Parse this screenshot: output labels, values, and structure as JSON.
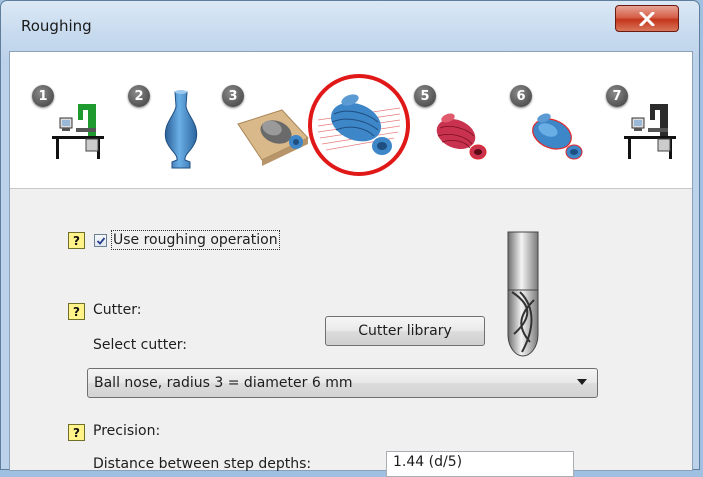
{
  "window": {
    "title": "Roughing",
    "close_glyph": "X"
  },
  "steps": [
    {
      "num": "1",
      "icon": "machine-workstation-icon"
    },
    {
      "num": "2",
      "icon": "vase-model-icon"
    },
    {
      "num": "3",
      "icon": "model-on-stock-icon"
    },
    {
      "num": "4",
      "icon": "roughing-toolpath-icon"
    },
    {
      "num": "5",
      "icon": "finishing-toolpath-icon"
    },
    {
      "num": "6",
      "icon": "contour-toolpath-icon"
    },
    {
      "num": "7",
      "icon": "machine-output-icon"
    }
  ],
  "active_step": "4",
  "form": {
    "help_glyph": "?",
    "use_roughing": {
      "checked": true,
      "label": "Use roughing operation"
    },
    "cutter": {
      "heading": "Cutter:",
      "select_label": "Select cutter:",
      "library_button": "Cutter library",
      "selected": "Ball nose, radius 3 = diameter 6 mm",
      "image": "ball-nose-end-mill-icon"
    },
    "precision": {
      "heading": "Precision:",
      "distance_label": "Distance between step depths:",
      "distance_value": "1.44 (d/5)"
    }
  },
  "colors": {
    "active_highlight": "#e01818",
    "model_blue": "#3d86c8",
    "toolpath_red": "#e02a2a"
  }
}
